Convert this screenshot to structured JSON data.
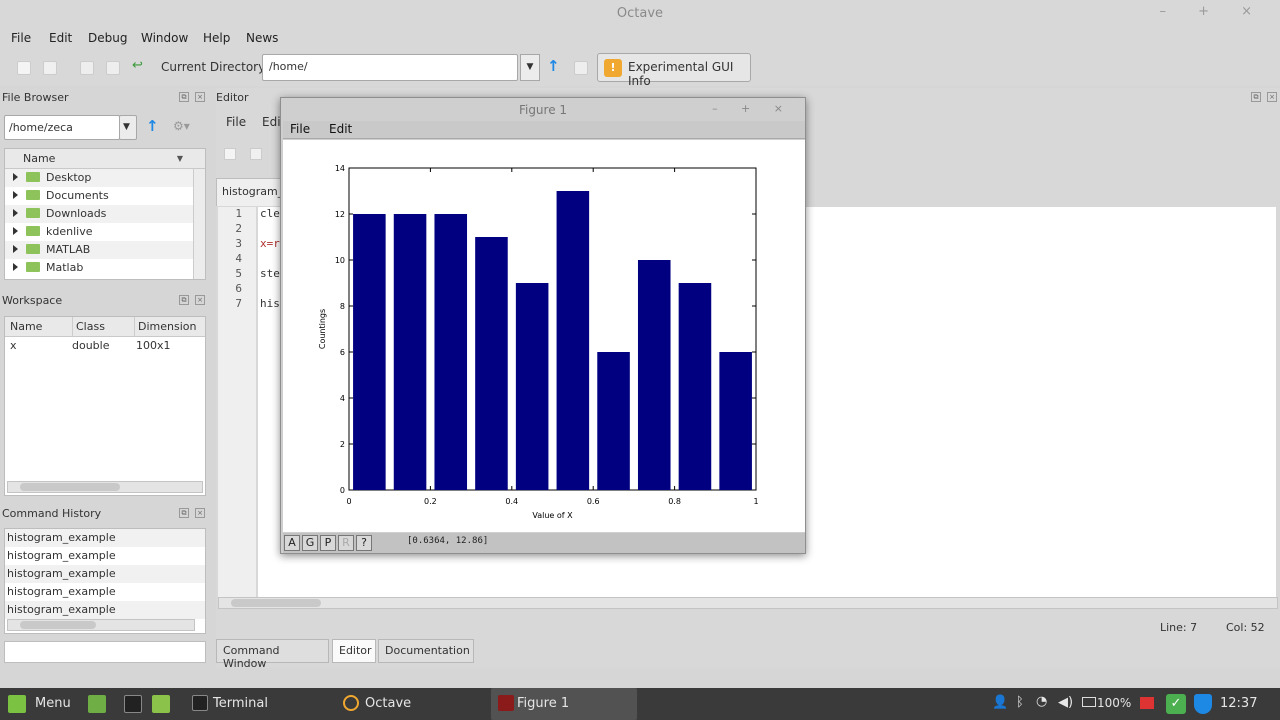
{
  "window": {
    "title": "Octave"
  },
  "menu": [
    "File",
    "Edit",
    "Debug",
    "Window",
    "Help",
    "News"
  ],
  "toolbar": {
    "current_dir_label": "Current Directory:",
    "current_dir_value": "/home/",
    "gui_info_label": "Experimental GUI Info"
  },
  "file_browser": {
    "title": "File Browser",
    "path": "/home/zeca",
    "column": "Name",
    "items": [
      "Desktop",
      "Documents",
      "Downloads",
      "kdenlive",
      "MATLAB",
      "Matlab"
    ]
  },
  "workspace": {
    "title": "Workspace",
    "columns": [
      "Name",
      "Class",
      "Dimension"
    ],
    "rows": [
      {
        "name": "x",
        "class": "double",
        "dimension": "100x1"
      }
    ]
  },
  "command_history": {
    "title": "Command History",
    "items": [
      "histogram_example",
      "histogram_example",
      "histogram_example",
      "histogram_example",
      "histogram_example"
    ]
  },
  "editor": {
    "title": "Editor",
    "menu": [
      "File",
      "Edit"
    ],
    "file_tab": "histogram_",
    "line_numbers": [
      "1",
      "2",
      "3",
      "4",
      "5",
      "6",
      "7"
    ],
    "code_lines": [
      "cle",
      "",
      "x=r",
      "",
      "ste",
      "",
      "his"
    ],
    "status_line": "Line:  7",
    "status_col": "Col:  52"
  },
  "bottom_tabs": [
    "Command Window",
    "Editor",
    "Documentation"
  ],
  "figure": {
    "title": "Figure 1",
    "menu": [
      "File",
      "Edit"
    ],
    "buttons": [
      "A",
      "G",
      "P",
      "R",
      "?"
    ],
    "coord_readout": "[0.6364, 12.86]"
  },
  "chart_data": {
    "type": "bar",
    "title": "",
    "xlabel": "Value of X",
    "ylabel": "Countings",
    "x": [
      0.05,
      0.15,
      0.25,
      0.35,
      0.45,
      0.55,
      0.65,
      0.75,
      0.85,
      0.95
    ],
    "values": [
      12,
      12,
      12,
      11,
      9,
      13,
      6,
      10,
      9,
      6
    ],
    "xlim": [
      0,
      1
    ],
    "ylim": [
      0,
      14
    ],
    "xticks": [
      "0",
      "0.2",
      "0.4",
      "0.6",
      "0.8",
      "1"
    ],
    "yticks": [
      "0",
      "2",
      "4",
      "6",
      "8",
      "10",
      "12",
      "14"
    ],
    "bar_color": "#000080",
    "grid": false
  },
  "taskbar": {
    "menu_label": "Menu",
    "tasks": [
      "Terminal",
      "Octave",
      "Figure 1"
    ],
    "battery": "100%",
    "clock": "12:37"
  },
  "colors": {
    "accent": "#1e88e5",
    "bar": "#000080"
  }
}
